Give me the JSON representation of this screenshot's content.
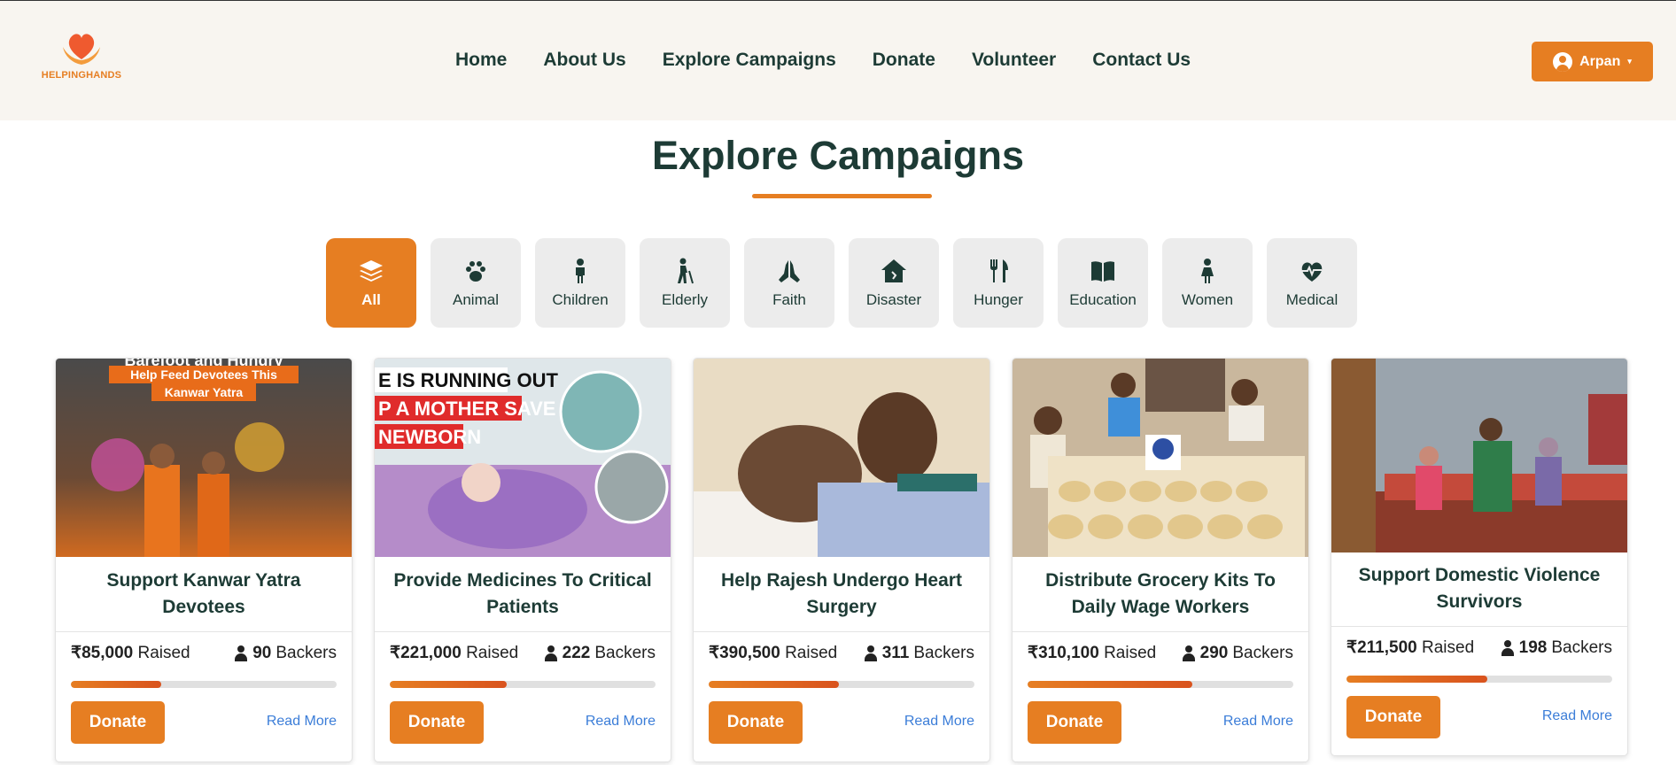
{
  "header": {
    "logo_text": "HELPINGHANDS",
    "nav": [
      "Home",
      "About Us",
      "Explore Campaigns",
      "Donate",
      "Volunteer",
      "Contact Us"
    ],
    "user": {
      "name": "Arpan",
      "icon": "user-circle-icon",
      "caret": "▾"
    }
  },
  "page": {
    "title": "Explore Campaigns"
  },
  "categories": [
    {
      "label": "All",
      "icon": "layers-icon",
      "active": true
    },
    {
      "label": "Animal",
      "icon": "paw-icon",
      "active": false
    },
    {
      "label": "Children",
      "icon": "child-icon",
      "active": false
    },
    {
      "label": "Elderly",
      "icon": "elderly-walking-icon",
      "active": false
    },
    {
      "label": "Faith",
      "icon": "praying-hands-icon",
      "active": false
    },
    {
      "label": "Disaster",
      "icon": "house-damage-icon",
      "active": false
    },
    {
      "label": "Hunger",
      "icon": "utensils-icon",
      "active": false
    },
    {
      "label": "Education",
      "icon": "book-open-icon",
      "active": false
    },
    {
      "label": "Women",
      "icon": "woman-icon",
      "active": false
    },
    {
      "label": "Medical",
      "icon": "heartbeat-icon",
      "active": false
    }
  ],
  "campaigns": [
    {
      "title": "Support Kanwar Yatra Devotees",
      "raised": "₹85,000",
      "raised_label": "Raised",
      "backers": "90",
      "backers_label": "Backers",
      "progress": 0.34,
      "donate": "Donate",
      "read_more": "Read More",
      "image_text": [
        "Barefoot and Hungry",
        "Help Feed Devotees This",
        "Kanwar Yatra"
      ]
    },
    {
      "title": "Provide Medicines To Critical Patients",
      "raised": "₹221,000",
      "raised_label": "Raised",
      "backers": "222",
      "backers_label": "Backers",
      "progress": 0.44,
      "donate": "Donate",
      "read_more": "Read More",
      "image_text": [
        "E IS RUNNING OUT",
        "P A MOTHER SAVE",
        "NEWBORN"
      ]
    },
    {
      "title": "Help Rajesh Undergo Heart Surgery",
      "raised": "₹390,500",
      "raised_label": "Raised",
      "backers": "311",
      "backers_label": "Backers",
      "progress": 0.49,
      "donate": "Donate",
      "read_more": "Read More"
    },
    {
      "title": "Distribute Grocery Kits To Daily Wage Workers",
      "raised": "₹310,100",
      "raised_label": "Raised",
      "backers": "290",
      "backers_label": "Backers",
      "progress": 0.62,
      "donate": "Donate",
      "read_more": "Read More"
    },
    {
      "title": "Support Domestic Violence Survivors",
      "raised": "₹211,500",
      "raised_label": "Raised",
      "backers": "198",
      "backers_label": "Backers",
      "progress": 0.53,
      "donate": "Donate",
      "read_more": "Read More"
    }
  ],
  "colors": {
    "accent": "#e67e22",
    "heading": "#1d3b35",
    "link": "#3b7dd8",
    "header_bg": "#f8f5f0"
  }
}
